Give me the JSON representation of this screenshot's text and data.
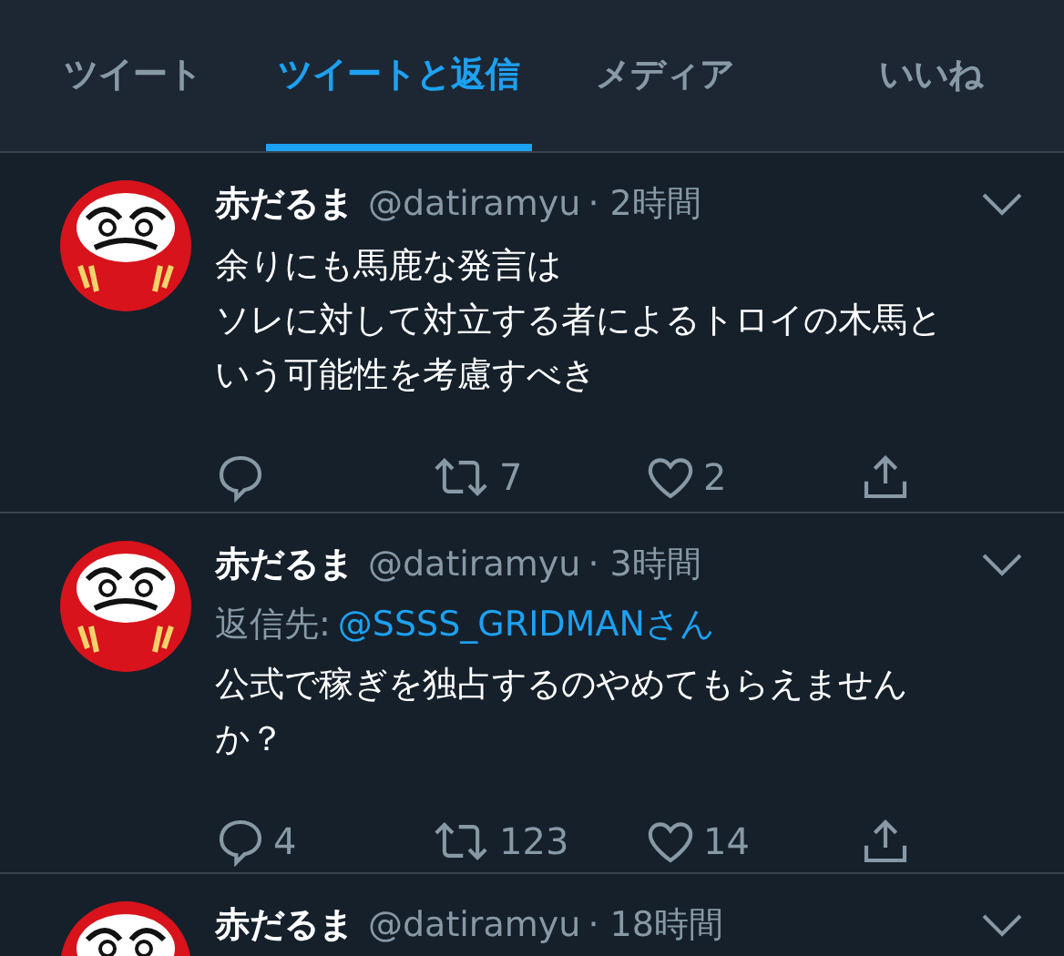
{
  "tabs": [
    {
      "label": "ツイート",
      "selected": false
    },
    {
      "label": "ツイートと返信",
      "selected": true
    },
    {
      "label": "メディア",
      "selected": false
    },
    {
      "label": "いいね",
      "selected": false
    }
  ],
  "tweets": [
    {
      "name": "赤だるま",
      "handle": "@datiramyu",
      "time": "· 2時間",
      "body_lines": [
        "余りにも馬鹿な発言は",
        "ソレに対して対立する者によるトロイの木馬と",
        "いう可能性を考慮すべき"
      ],
      "retweets": "7",
      "likes": "2"
    },
    {
      "name": "赤だるま",
      "handle": "@datiramyu",
      "time": "· 3時間",
      "reply_to": {
        "label": "返信先:",
        "user": "@SSSS_GRIDMANさん"
      },
      "body_lines": [
        "公式で稼ぎを独占するのやめてもらえません",
        "か？"
      ],
      "replies": "4",
      "retweets": "123",
      "likes": "14"
    },
    {
      "name": "赤だるま",
      "handle": "@datiramyu",
      "time": "· 18時間"
    }
  ]
}
